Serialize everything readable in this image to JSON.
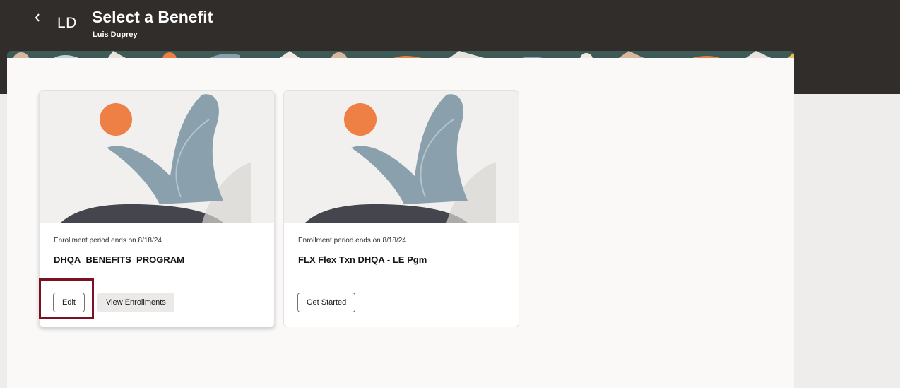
{
  "header": {
    "back_icon": "chevron-left-icon",
    "initials": "LD",
    "title": "Select a Benefit",
    "person_name": "Luis Duprey"
  },
  "cards": [
    {
      "period_text": "Enrollment period ends on 8/18/24",
      "program_name": "DHQA_BENEFITS_PROGRAM",
      "primary_button": "Edit",
      "secondary_button": "View Enrollments"
    },
    {
      "period_text": "Enrollment period ends on 8/18/24",
      "program_name": "FLX Flex Txn DHQA - LE Pgm",
      "primary_button": "Get Started"
    }
  ],
  "colors": {
    "header_bg": "#312d2a",
    "highlight": "#7a1224",
    "art_orange": "#ee7f45",
    "art_blue": "#8aa1ad",
    "art_dark": "#45464d"
  }
}
